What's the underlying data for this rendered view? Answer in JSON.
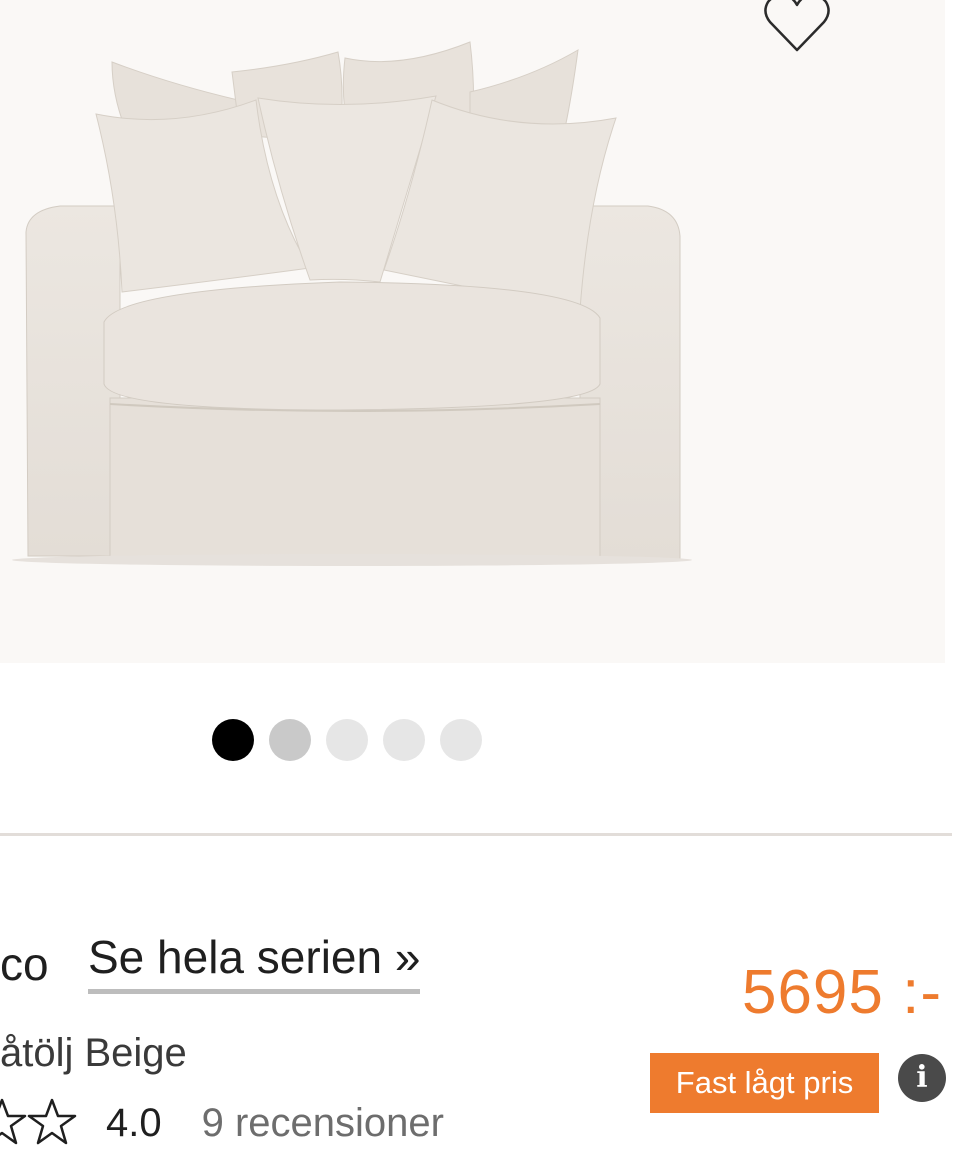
{
  "gallery": {
    "image_alt": "Beige armchair with loose cushions",
    "dots": [
      {
        "state": "active"
      },
      {
        "state": "second"
      },
      {
        "state": "inactive"
      },
      {
        "state": "inactive"
      },
      {
        "state": "inactive"
      }
    ],
    "favorite_icon": "heart-outline-icon"
  },
  "product": {
    "brand_fragment": "co",
    "series_link": "Se hela serien »",
    "name_fragment": "åtölj Beige",
    "stars_icon": "star-outline-icon",
    "rating": "4.0",
    "reviews_link": "9 recensioner",
    "price": "5695 :-",
    "badge": "Fast lågt pris",
    "info_icon": "info-icon",
    "info_glyph": "i"
  },
  "colors": {
    "accent": "#ee7b2e",
    "hero_bg": "#faf8f6",
    "upholstery": "#e9e4de"
  }
}
